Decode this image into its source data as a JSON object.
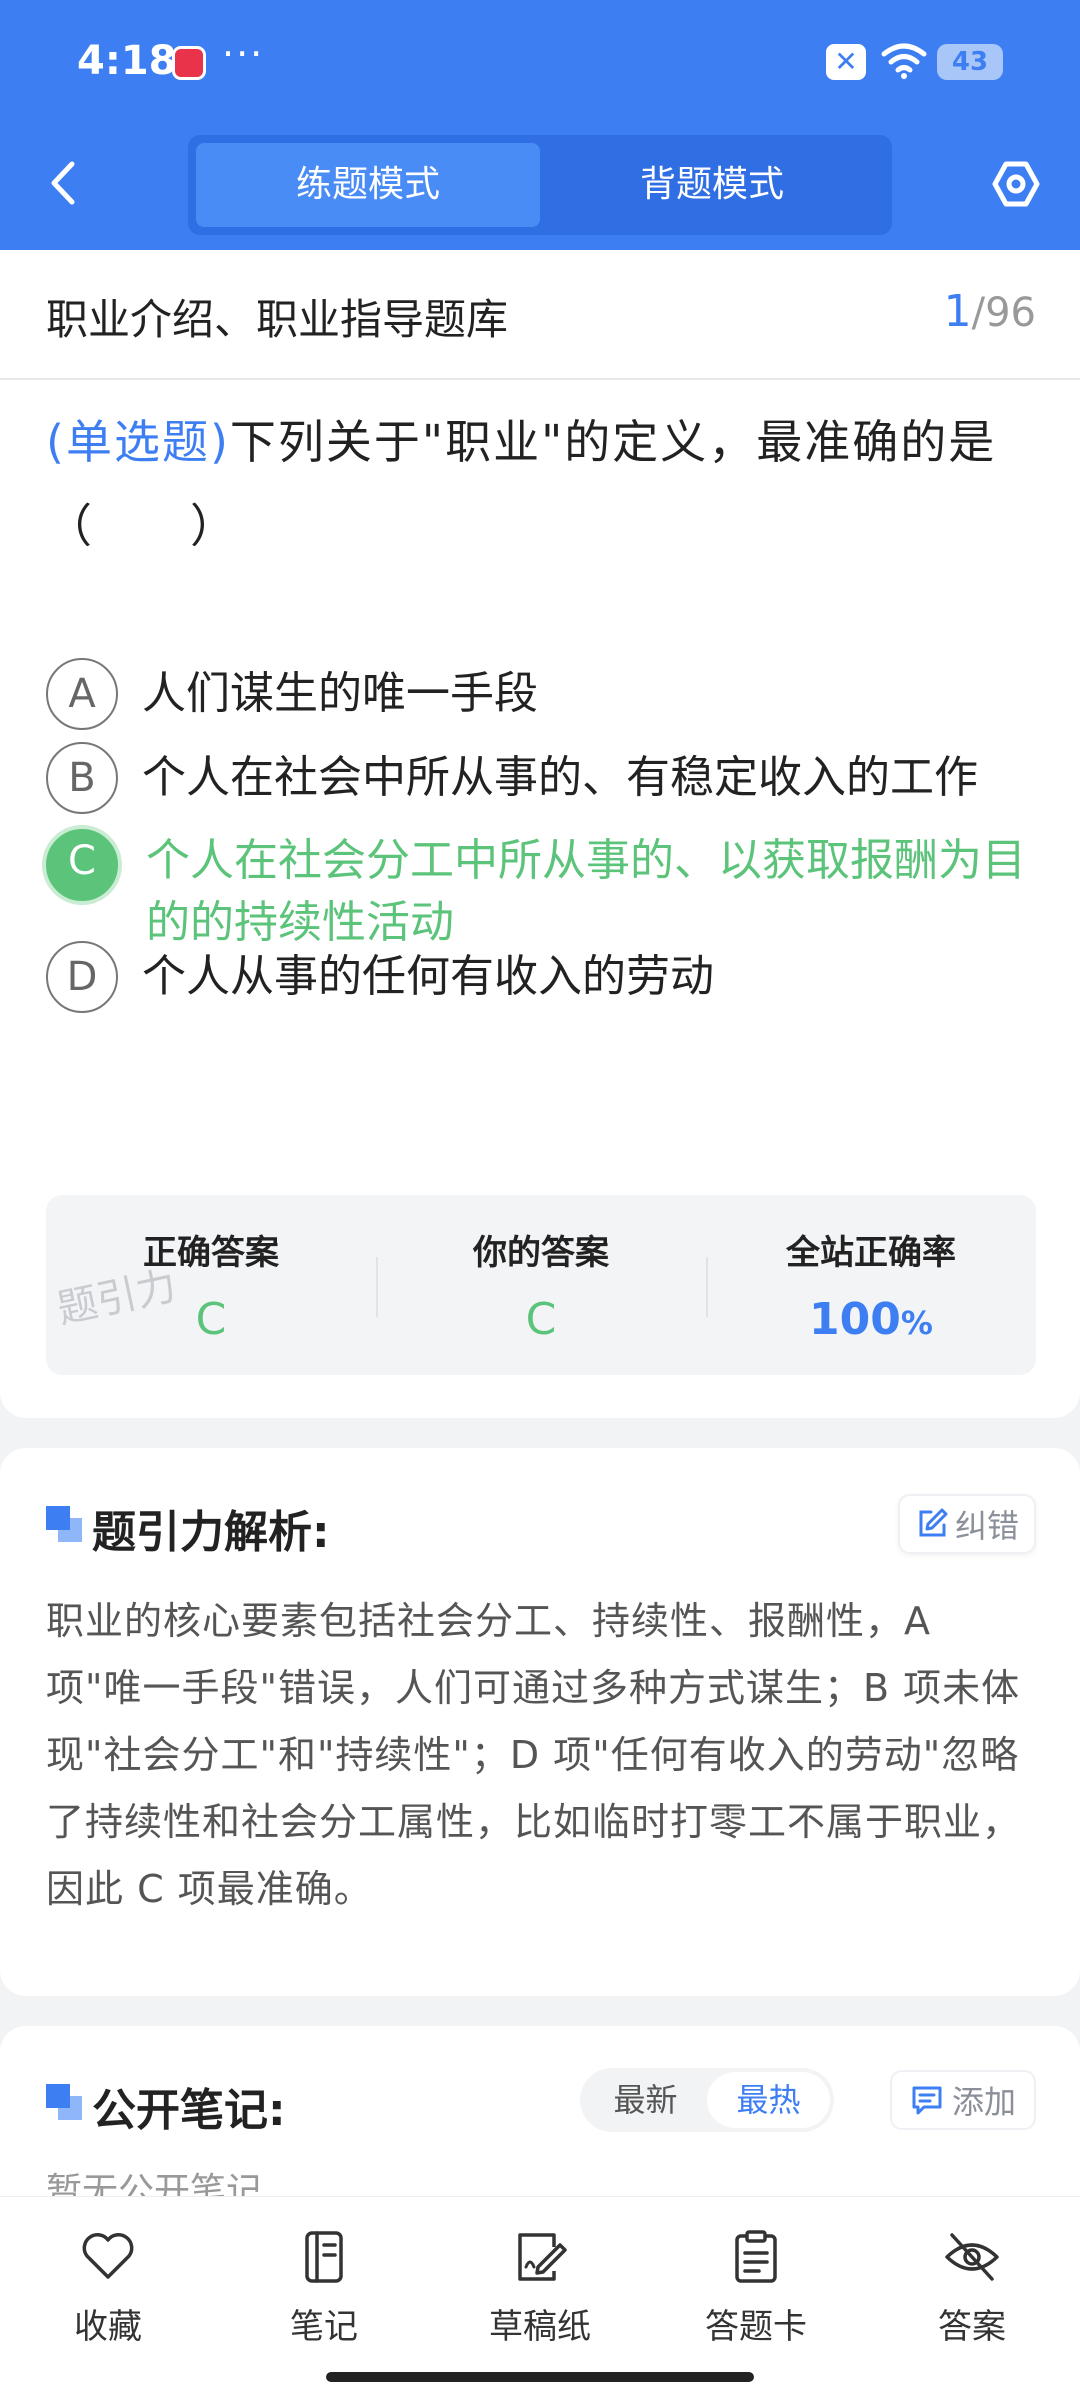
{
  "status_bar": {
    "time": "4:18",
    "dots": "···",
    "battery": "43"
  },
  "header": {
    "tabs": [
      {
        "label": "练题模式",
        "active": true
      },
      {
        "label": "背题模式",
        "active": false
      }
    ]
  },
  "question": {
    "bank_title": "职业介绍、职业指导题库",
    "current": "1",
    "total": "/96",
    "type": "(单选题)",
    "text": "下列关于\"职业\"的定义，最准确的是（　　）",
    "options": [
      {
        "letter": "A",
        "text": "人们谋生的唯一手段"
      },
      {
        "letter": "B",
        "text": "个人在社会中所从事的、有稳定收入的工作"
      },
      {
        "letter": "C",
        "text": "个人在社会分工中所从事的、以获取报酬为目的的持续性活动"
      },
      {
        "letter": "D",
        "text": "个人从事的任何有收入的劳动"
      }
    ]
  },
  "stats": {
    "correct_label": "正确答案",
    "correct_value": "C",
    "yours_label": "你的答案",
    "yours_value": "C",
    "rate_label": "全站正确率",
    "rate_value": "100",
    "rate_unit": "%",
    "watermark": "题引力"
  },
  "analysis": {
    "title": "题引力解析:",
    "correct_button": "纠错",
    "text": "职业的核心要素包括社会分工、持续性、报酬性，A 项\"唯一手段\"错误，人们可通过多种方式谋生；B 项未体现\"社会分工\"和\"持续性\"；D 项\"任何有收入的劳动\"忽略了持续性和社会分工属性，比如临时打零工不属于职业，因此 C 项最准确。"
  },
  "notes": {
    "title": "公开笔记:",
    "sort_latest": "最新",
    "sort_hot": "最热",
    "add_button": "添加",
    "empty": "暂无公开笔记"
  },
  "bottom_nav": {
    "favorite": "收藏",
    "notes": "笔记",
    "scratch": "草稿纸",
    "answer_card": "答题卡",
    "answer": "答案"
  }
}
